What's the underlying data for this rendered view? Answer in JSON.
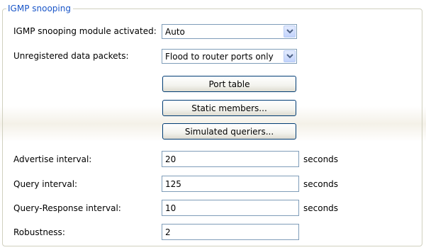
{
  "group": {
    "title": "IGMP snooping"
  },
  "module_activated": {
    "label": "IGMP snooping module activated:",
    "value": "Auto"
  },
  "unregistered_packets": {
    "label": "Unregistered data packets:",
    "value": "Flood to router ports only"
  },
  "buttons": {
    "port_table": "Port table",
    "static_members": "Static members...",
    "simulated_queriers": "Simulated queriers..."
  },
  "advertise_interval": {
    "label": "Advertise interval:",
    "value": "20",
    "unit": "seconds"
  },
  "query_interval": {
    "label": "Query interval:",
    "value": "125",
    "unit": "seconds"
  },
  "query_response_interval": {
    "label": "Query-Response interval:",
    "value": "10",
    "unit": "seconds"
  },
  "robustness": {
    "label": "Robustness:",
    "value": "2"
  },
  "icons": {
    "dropdown": "chevron-down-icon"
  },
  "colors": {
    "group_title": "#1a56c8",
    "button_border": "#003c74",
    "field_border": "#7f9db9"
  }
}
